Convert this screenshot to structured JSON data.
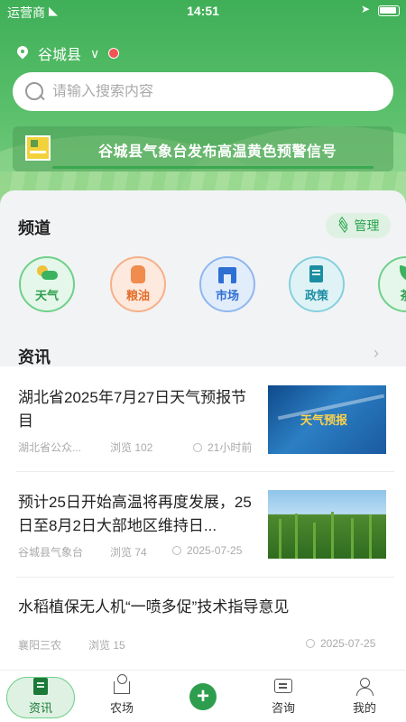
{
  "status_bar": {
    "carrier": "运营商",
    "time": "14:51"
  },
  "location": {
    "county": "谷城县"
  },
  "search": {
    "placeholder": "请输入搜索内容"
  },
  "banner": {
    "text": "谷城县气象台发布高温黄色预警信号"
  },
  "channels": {
    "title": "频道",
    "manage_label": "管理",
    "items": [
      {
        "label": "天气",
        "icon": "weather-icon"
      },
      {
        "label": "粮油",
        "icon": "grain-oil-icon"
      },
      {
        "label": "市场",
        "icon": "market-icon"
      },
      {
        "label": "政策",
        "icon": "policy-icon"
      },
      {
        "label": "茶",
        "icon": "tea-icon"
      }
    ]
  },
  "news": {
    "title": "资讯",
    "items": [
      {
        "title": "湖北省2025年7月27日天气预报节目",
        "source": "湖北省公众...",
        "views": "浏览 102",
        "time": "21小时前",
        "thumb_text": "天气预报"
      },
      {
        "title": "预计25日开始高温将再度发展，25日至8月2日大部地区维持日...",
        "source": "谷城县气象台",
        "views": "浏览 74",
        "time": "2025-07-25"
      },
      {
        "title": "水稻植保无人机“一喷多促”技术指导意见",
        "source": "襄阳三农",
        "views": "浏览 15",
        "time": "2025-07-25"
      }
    ]
  },
  "tabbar": {
    "items": [
      {
        "label": "资讯",
        "icon": "news-icon",
        "active": true
      },
      {
        "label": "农场",
        "icon": "farm-icon"
      },
      {
        "label": "",
        "icon": "plus-icon"
      },
      {
        "label": "咨询",
        "icon": "consult-icon"
      },
      {
        "label": "我的",
        "icon": "user-icon"
      }
    ]
  },
  "colors": {
    "brand_green": "#2e9e4e",
    "header_green": "#4db463",
    "alert_red": "#f15454"
  }
}
